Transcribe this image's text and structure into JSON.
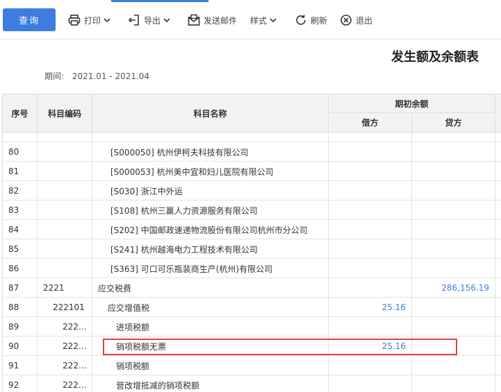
{
  "toolbar": {
    "query": "查询",
    "print": "打印",
    "export": "导出",
    "send_mail": "发送邮件",
    "style": "样式",
    "refresh": "刷新",
    "exit": "退出"
  },
  "report": {
    "title": "发生额及余额表",
    "period_label": "期间:",
    "period_value": "2021.01 - 2021.04"
  },
  "table": {
    "headers": {
      "seq": "序号",
      "code": "科目编码",
      "name": "科目名称",
      "opening_balance": "期初余额",
      "debit": "借方",
      "credit": "贷方"
    },
    "rows": [
      {
        "seq": "80",
        "code": "",
        "name": "[S000050] 杭州伊柯夫科技有限公司",
        "debit": "",
        "credit": ""
      },
      {
        "seq": "81",
        "code": "",
        "name": "[S000053] 杭州美中宜和妇儿医院有限公司",
        "debit": "",
        "credit": ""
      },
      {
        "seq": "82",
        "code": "",
        "name": "[S030] 浙江中外运",
        "debit": "",
        "credit": ""
      },
      {
        "seq": "83",
        "code": "",
        "name": "[S108] 杭州三赢人力资源服务有限公司",
        "debit": "",
        "credit": ""
      },
      {
        "seq": "84",
        "code": "",
        "name": "[S202] 中国邮政速递物流股份有限公司杭州市分公司",
        "debit": "",
        "credit": ""
      },
      {
        "seq": "85",
        "code": "",
        "name": "[S241] 杭州越海电力工程技术有限公司",
        "debit": "",
        "credit": ""
      },
      {
        "seq": "86",
        "code": "",
        "name": "[S363] 可口可乐瓶装商生产(杭州)有限公司",
        "debit": "",
        "credit": ""
      },
      {
        "seq": "87",
        "code": "2221",
        "name": "应交税费",
        "debit": "",
        "credit": "286,156.19"
      },
      {
        "seq": "88",
        "code": "222101",
        "name": "应交增值税",
        "debit": "25.16",
        "credit": ""
      },
      {
        "seq": "89",
        "code": "222…",
        "name": "进项税额",
        "debit": "",
        "credit": ""
      },
      {
        "seq": "90",
        "code": "222…",
        "name": "销项税额无票",
        "debit": "25.16",
        "credit": ""
      },
      {
        "seq": "91",
        "code": "222…",
        "name": "销项税额",
        "debit": "",
        "credit": ""
      },
      {
        "seq": "92",
        "code": "222…",
        "name": "营改增抵减的销项税额",
        "debit": "",
        "credit": ""
      }
    ]
  },
  "colors": {
    "accent": "#3d7de0",
    "highlight": "#e04040"
  }
}
